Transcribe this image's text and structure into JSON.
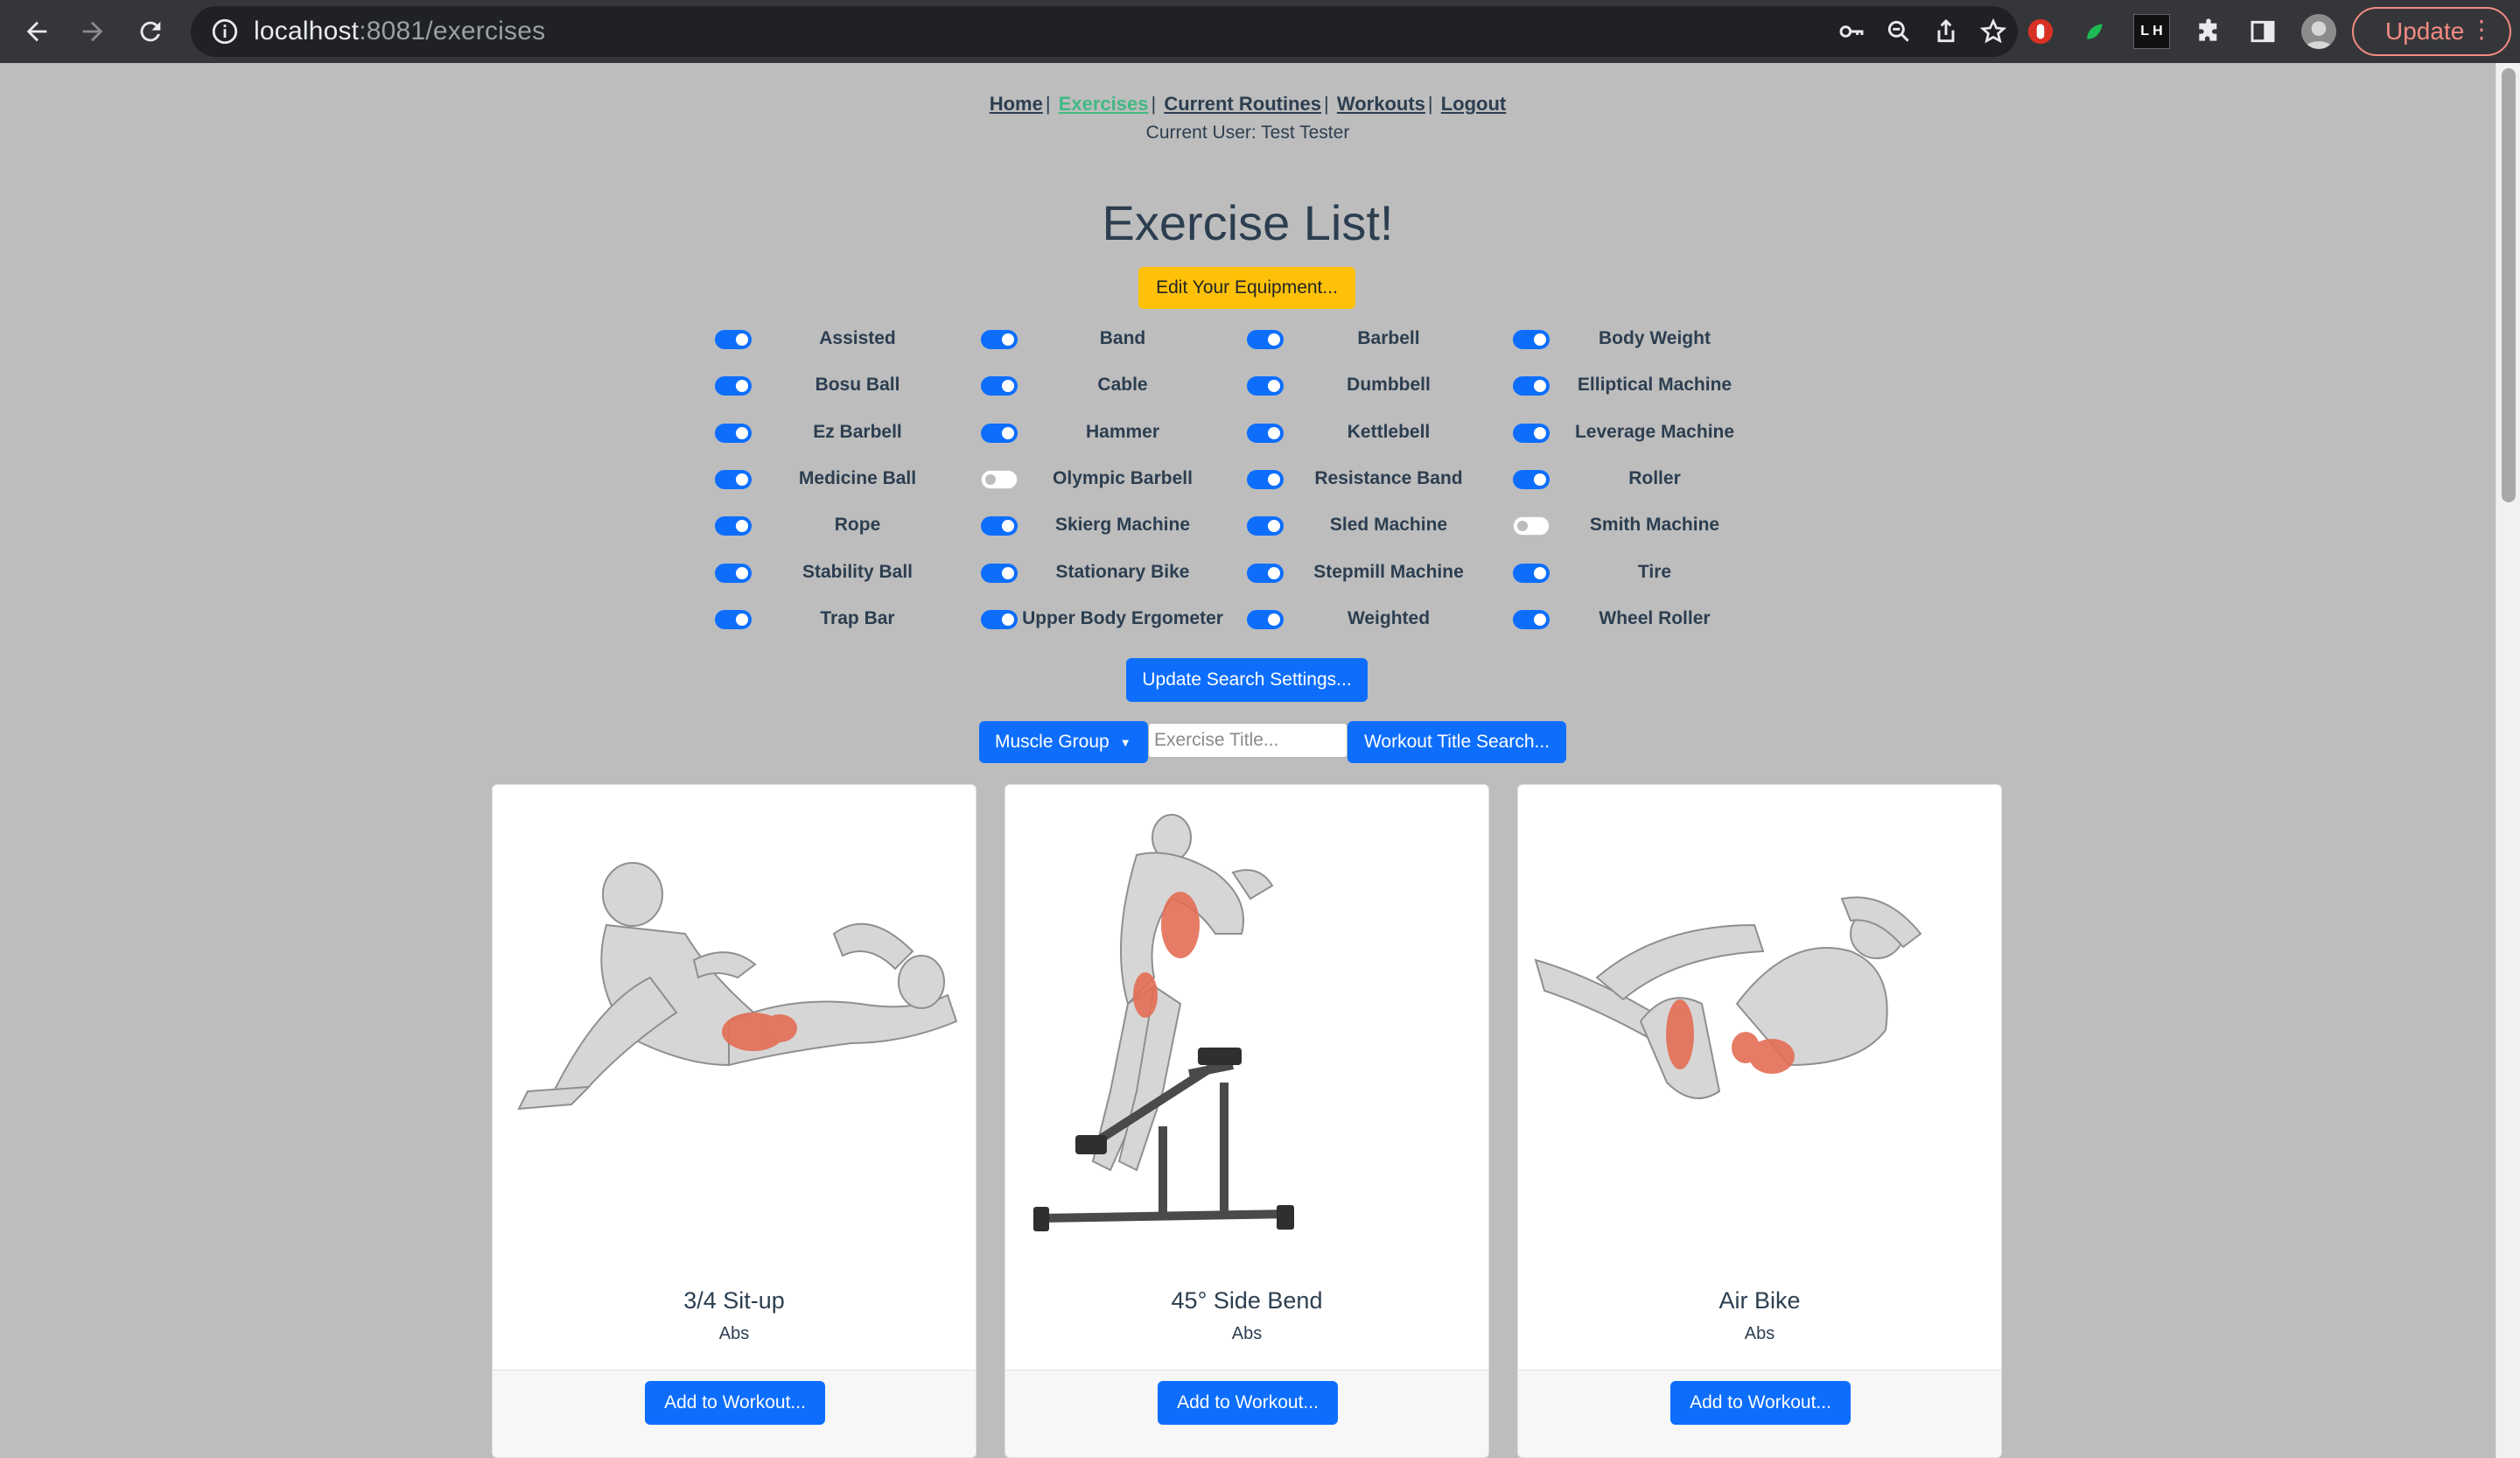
{
  "browser": {
    "url_host": "localhost",
    "url_path": ":8081/exercises",
    "update_label": "Update",
    "ext_lh": "L H"
  },
  "nav": {
    "links": [
      "Home",
      "Exercises",
      "Current Routines",
      "Workouts",
      "Logout"
    ],
    "separator": "|",
    "current_user": "Current User: Test Tester"
  },
  "page": {
    "title": "Exercise List!",
    "edit_equipment_label": "Edit Your Equipment...",
    "update_search_label": "Update Search Settings..."
  },
  "equipment": [
    {
      "label": "Assisted",
      "enabled": true
    },
    {
      "label": "Band",
      "enabled": true
    },
    {
      "label": "Barbell",
      "enabled": true
    },
    {
      "label": "Body Weight",
      "enabled": true
    },
    {
      "label": "Bosu Ball",
      "enabled": true
    },
    {
      "label": "Cable",
      "enabled": true
    },
    {
      "label": "Dumbbell",
      "enabled": true
    },
    {
      "label": "Elliptical Machine",
      "enabled": true
    },
    {
      "label": "Ez Barbell",
      "enabled": true
    },
    {
      "label": "Hammer",
      "enabled": true
    },
    {
      "label": "Kettlebell",
      "enabled": true
    },
    {
      "label": "Leverage Machine",
      "enabled": true
    },
    {
      "label": "Medicine Ball",
      "enabled": true
    },
    {
      "label": "Olympic Barbell",
      "enabled": false
    },
    {
      "label": "Resistance Band",
      "enabled": true
    },
    {
      "label": "Roller",
      "enabled": true
    },
    {
      "label": "Rope",
      "enabled": true
    },
    {
      "label": "Skierg Machine",
      "enabled": true
    },
    {
      "label": "Sled Machine",
      "enabled": true
    },
    {
      "label": "Smith Machine",
      "enabled": false
    },
    {
      "label": "Stability Ball",
      "enabled": true
    },
    {
      "label": "Stationary Bike",
      "enabled": true
    },
    {
      "label": "Stepmill Machine",
      "enabled": true
    },
    {
      "label": "Tire",
      "enabled": true
    },
    {
      "label": "Trap Bar",
      "enabled": true
    },
    {
      "label": "Upper Body Ergometer",
      "enabled": true
    },
    {
      "label": "Weighted",
      "enabled": true
    },
    {
      "label": "Wheel Roller",
      "enabled": true
    }
  ],
  "search": {
    "muscle_group_label": "Muscle Group",
    "exercise_title_placeholder": "Exercise Title...",
    "workout_title_label": "Workout Title Search..."
  },
  "cards": [
    {
      "title": "3/4 Sit-up",
      "muscle": "Abs",
      "button": "Add to Workout..."
    },
    {
      "title": "45° Side Bend",
      "muscle": "Abs",
      "button": "Add to Workout..."
    },
    {
      "title": "Air Bike",
      "muscle": "Abs",
      "button": "Add to Workout..."
    }
  ],
  "colors": {
    "page_bg": "#bdbdbd",
    "primary": "#0d6efd",
    "warning": "#ffc107",
    "active_link": "#42b983",
    "text": "#2c3e50"
  }
}
